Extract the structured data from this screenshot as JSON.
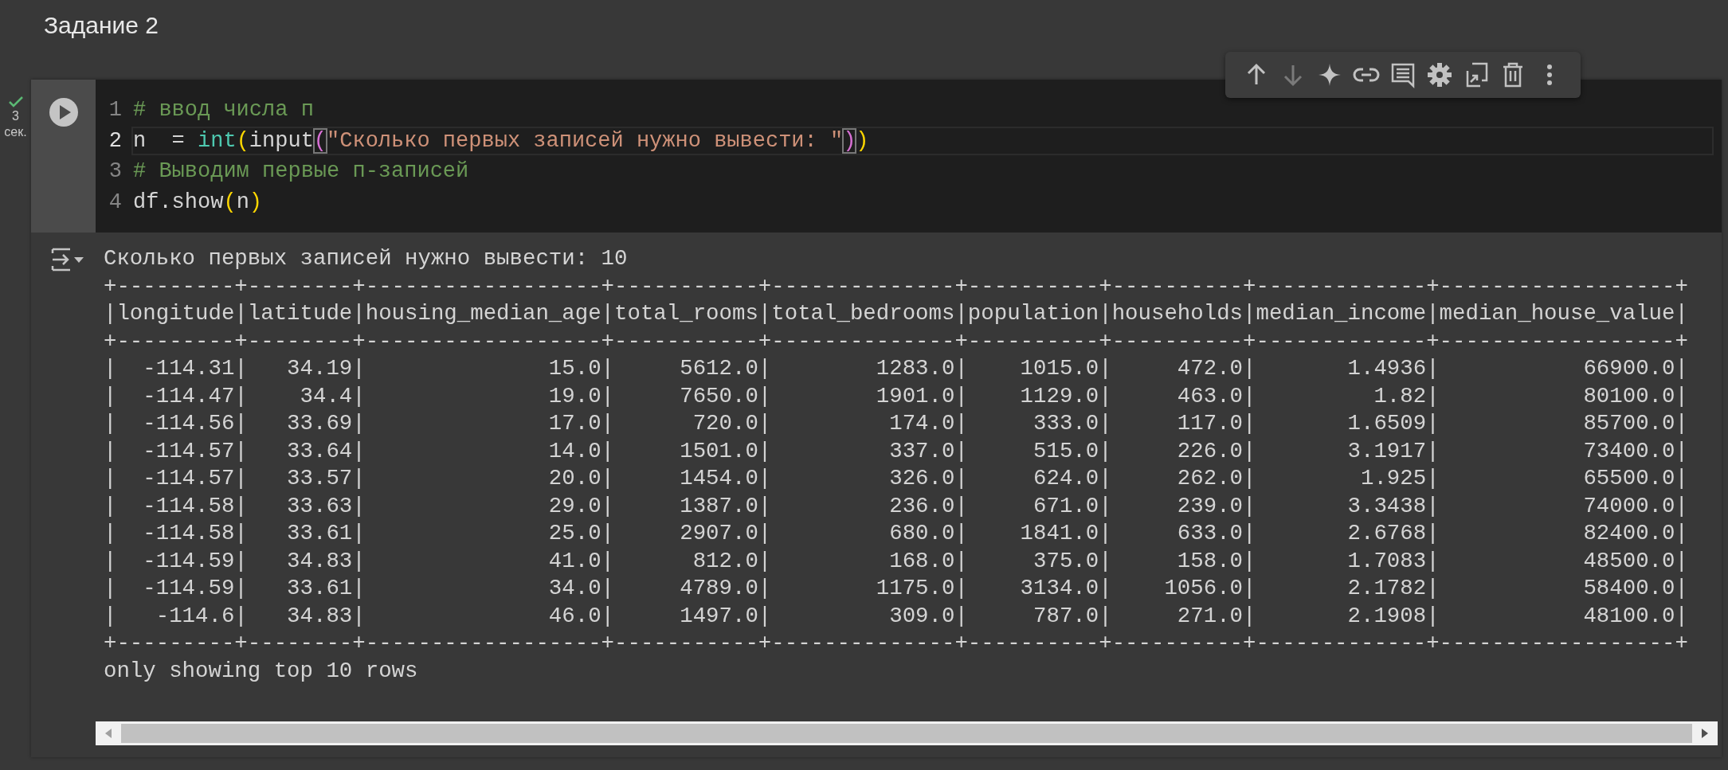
{
  "section_title": "Задание 2",
  "cell_toolbar": [
    {
      "kind": "up",
      "disabled": false
    },
    {
      "kind": "down",
      "disabled": true
    },
    {
      "kind": "sparkle",
      "disabled": false
    },
    {
      "kind": "link",
      "disabled": false
    },
    {
      "kind": "comment",
      "disabled": false
    },
    {
      "kind": "settings",
      "disabled": false
    },
    {
      "kind": "mirror",
      "disabled": false
    },
    {
      "kind": "delete",
      "disabled": false
    },
    {
      "kind": "more",
      "disabled": false
    }
  ],
  "execution": {
    "success": true,
    "duration": "3",
    "unit": "сек."
  },
  "code_lines": [
    {
      "number": "1",
      "active": false,
      "tokens": [
        {
          "kind": "comment",
          "text": "# ввод числа п"
        }
      ]
    },
    {
      "number": "2",
      "active": true,
      "tokens": [
        {
          "kind": "plain",
          "text": "n  = "
        },
        {
          "kind": "builtin",
          "text": "int"
        },
        {
          "kind": "paren1",
          "text": "("
        },
        {
          "kind": "plain",
          "text": "input"
        },
        {
          "kind": "paren2",
          "text": "(",
          "matched": true
        },
        {
          "kind": "string",
          "text": "\"Сколько первых записей нужно вывести: \""
        },
        {
          "kind": "paren2",
          "text": ")",
          "matched": true
        },
        {
          "kind": "paren1",
          "text": ")"
        }
      ]
    },
    {
      "number": "3",
      "active": false,
      "tokens": [
        {
          "kind": "comment",
          "text": "# Выводим первые п-записей"
        }
      ]
    },
    {
      "number": "4",
      "active": false,
      "tokens": [
        {
          "kind": "plain",
          "text": "df.show"
        },
        {
          "kind": "paren1",
          "text": "("
        },
        {
          "kind": "plain",
          "text": "n"
        },
        {
          "kind": "paren1",
          "text": ")"
        }
      ]
    }
  ],
  "output": {
    "prompt_line": "Сколько первых записей нужно вывести: 10",
    "table_lines": [
      "+---------+--------+------------------+-----------+--------------+----------+----------+-------------+------------------+",
      "|longitude|latitude|housing_median_age|total_rooms|total_bedrooms|population|households|median_income|median_house_value|",
      "+---------+--------+------------------+-----------+--------------+----------+----------+-------------+------------------+",
      "|  -114.31|   34.19|              15.0|     5612.0|        1283.0|    1015.0|     472.0|       1.4936|           66900.0|",
      "|  -114.47|    34.4|              19.0|     7650.0|        1901.0|    1129.0|     463.0|         1.82|           80100.0|",
      "|  -114.56|   33.69|              17.0|      720.0|         174.0|     333.0|     117.0|       1.6509|           85700.0|",
      "|  -114.57|   33.64|              14.0|     1501.0|         337.0|     515.0|     226.0|       3.1917|           73400.0|",
      "|  -114.57|   33.57|              20.0|     1454.0|         326.0|     624.0|     262.0|        1.925|           65500.0|",
      "|  -114.58|   33.63|              29.0|     1387.0|         236.0|     671.0|     239.0|       3.3438|           74000.0|",
      "|  -114.58|   33.61|              25.0|     2907.0|         680.0|    1841.0|     633.0|       2.6768|           82400.0|",
      "|  -114.59|   34.83|              41.0|      812.0|         168.0|     375.0|     158.0|       1.7083|           48500.0|",
      "|  -114.59|   33.61|              34.0|     4789.0|        1175.0|    3134.0|    1056.0|       2.1782|           58400.0|",
      "|   -114.6|   34.83|              46.0|     1497.0|         309.0|     787.0|     271.0|       2.1908|           48100.0|",
      "+---------+--------+------------------+-----------+--------------+----------+----------+-------------+------------------+"
    ],
    "footer": "only showing top 10 rows"
  }
}
